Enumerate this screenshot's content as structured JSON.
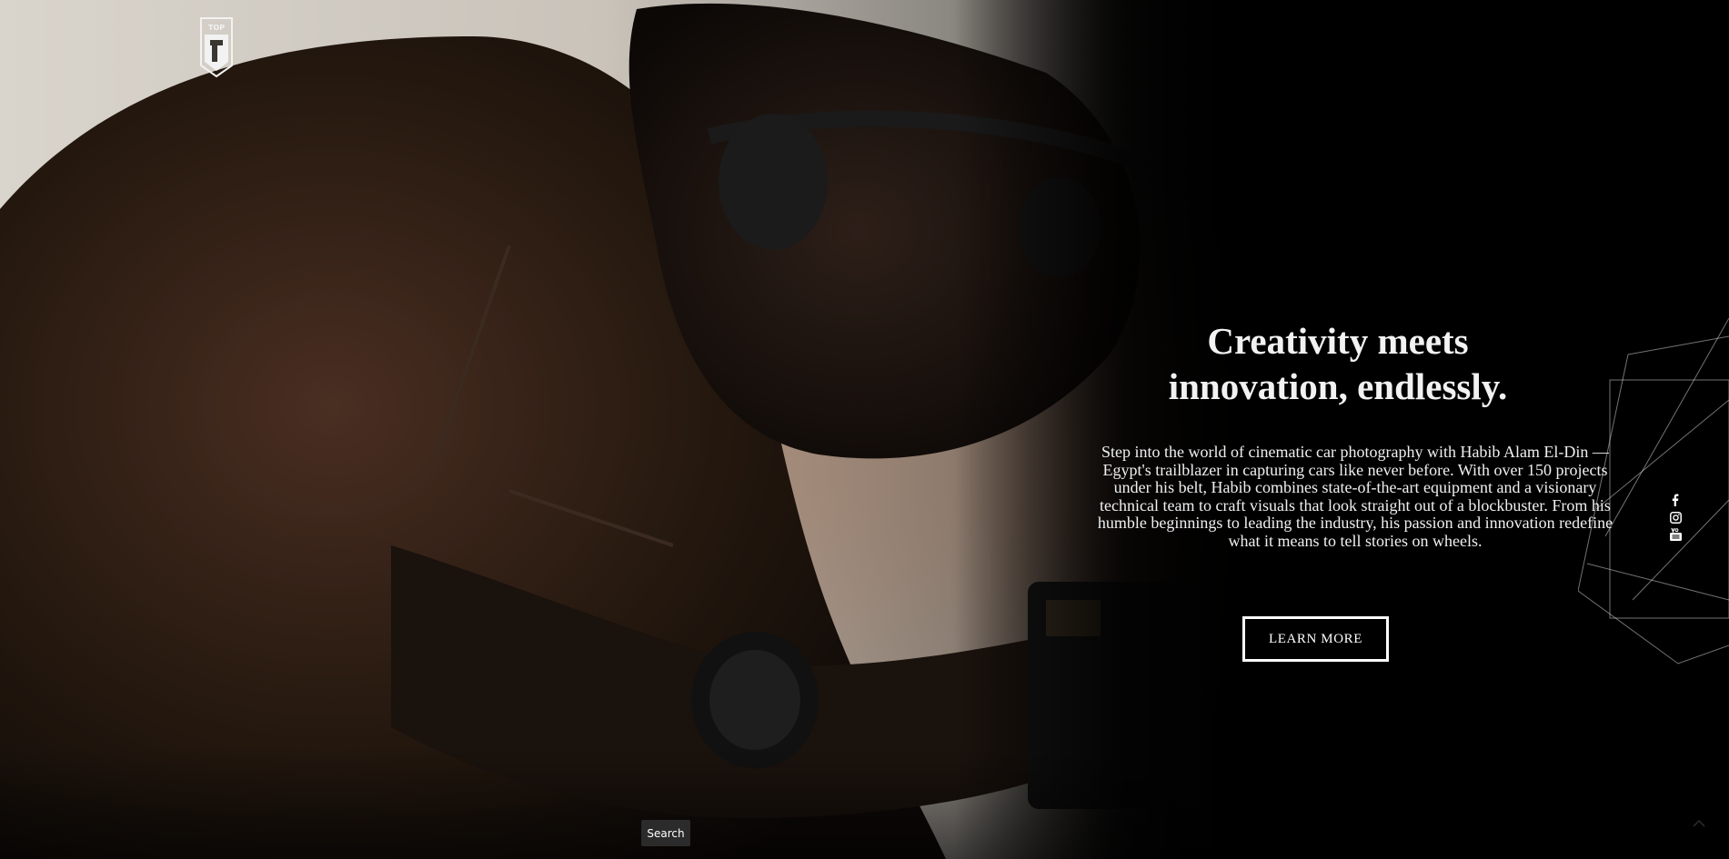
{
  "brand": {
    "logo_text": "TOP"
  },
  "hero": {
    "headline_line1": "Creativity meets",
    "headline_line2": "innovation, endlessly.",
    "body": "Step into the world of cinematic car photography with Habib Alam El-Din — Egypt's trailblazer in capturing cars like never before. With over 150 projects under his belt, Habib combines state-of-the-art equipment and a visionary technical team to craft visuals that look straight out of a blockbuster. From his humble beginnings to leading the industry, his passion and innovation redefine what it means to tell stories on wheels.",
    "cta_label": "LEARN MORE"
  },
  "social": [
    {
      "name": "facebook-icon"
    },
    {
      "name": "instagram-icon"
    },
    {
      "name": "youtube-icon"
    }
  ],
  "search": {
    "label": "Search"
  },
  "colors": {
    "background": "#000000",
    "text": "#ffffff",
    "search_bg": "#2b2b2b"
  }
}
